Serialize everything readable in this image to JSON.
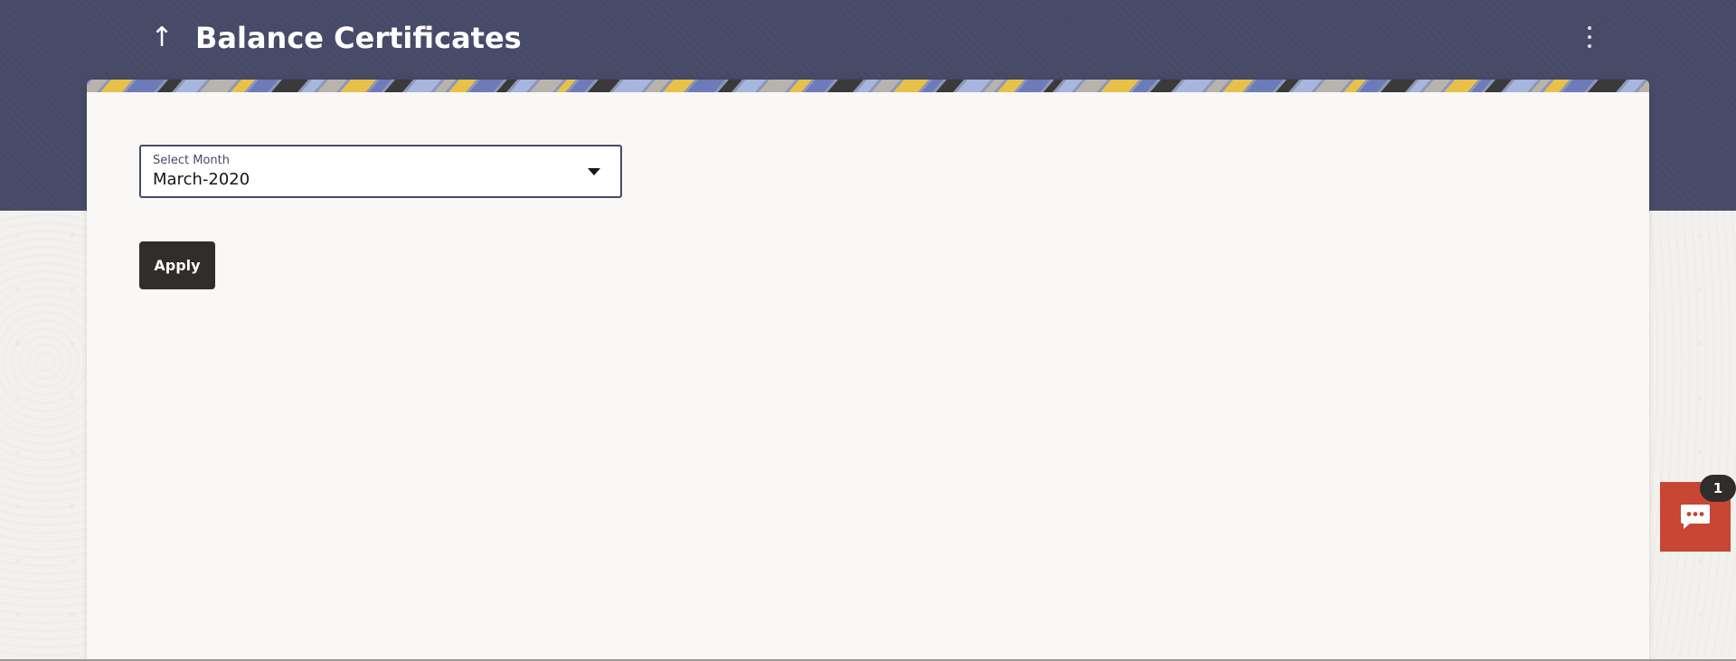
{
  "header": {
    "title": "Balance Certificates",
    "back_icon": "arrow-up-icon",
    "menu_icon": "kebab-menu-icon",
    "background_color": "#474a67"
  },
  "form": {
    "month_select": {
      "label": "Select Month",
      "value": "March-2020",
      "icon": "caret-down-icon"
    },
    "apply_label": "Apply"
  },
  "chat": {
    "icon": "chat-bubble-icon",
    "badge_count": "1",
    "color": "#c74634"
  },
  "colors": {
    "primary_button": "#312d2a",
    "card_background": "#faf8f7",
    "banner": [
      "#a8b5dc",
      "#e8c14a",
      "#3a3a3a",
      "#b8b4ad",
      "#6d7bb8"
    ]
  }
}
